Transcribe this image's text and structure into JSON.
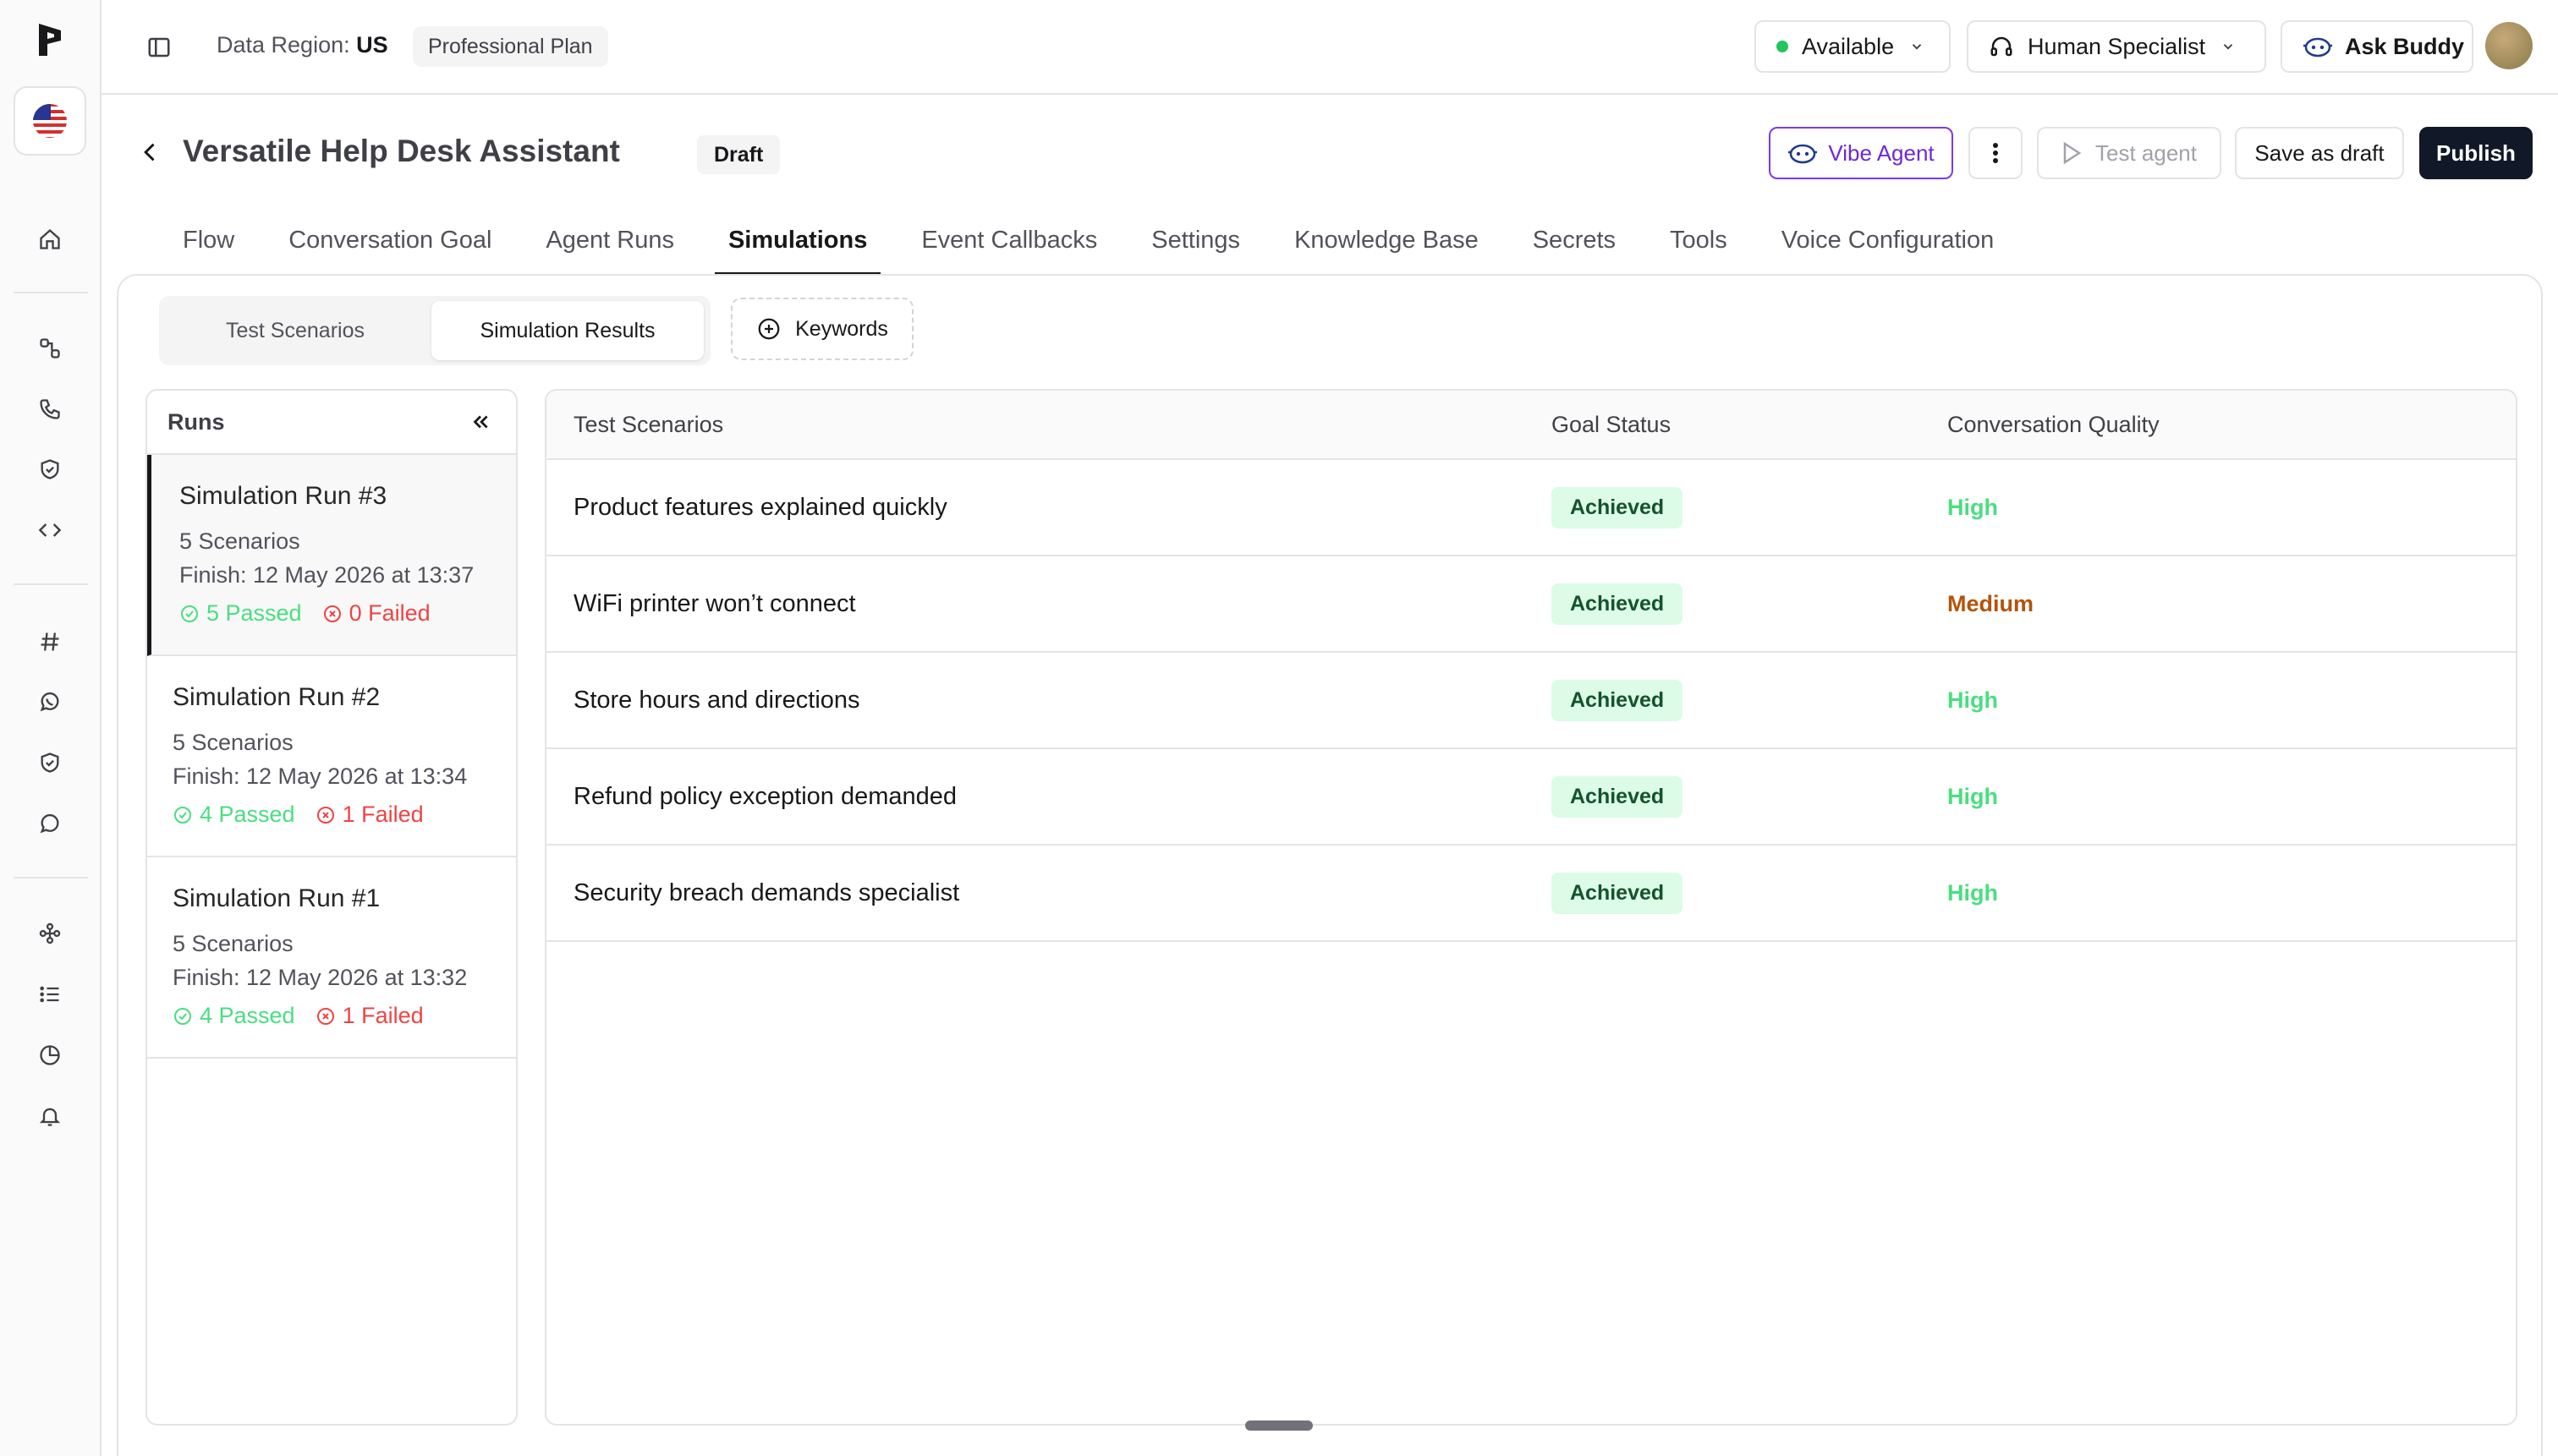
{
  "topbar": {
    "region_label": "Data Region:",
    "region_value": "US",
    "plan": "Professional Plan",
    "availability": "Available",
    "specialist": "Human Specialist",
    "ask_buddy": "Ask Buddy"
  },
  "header": {
    "title": "Versatile Help Desk Assistant",
    "status": "Draft",
    "vibe_agent": "Vibe Agent",
    "test_agent": "Test agent",
    "save_draft": "Save as draft",
    "publish": "Publish"
  },
  "tabs": [
    {
      "label": "Flow"
    },
    {
      "label": "Conversation Goal"
    },
    {
      "label": "Agent Runs"
    },
    {
      "label": "Simulations"
    },
    {
      "label": "Event Callbacks"
    },
    {
      "label": "Settings"
    },
    {
      "label": "Knowledge Base"
    },
    {
      "label": "Secrets"
    },
    {
      "label": "Tools"
    },
    {
      "label": "Voice Configuration"
    }
  ],
  "active_tab": "Simulations",
  "subtabs": {
    "test_scenarios": "Test Scenarios",
    "simulation_results": "Simulation Results",
    "keywords": "Keywords"
  },
  "runs": {
    "title": "Runs",
    "items": [
      {
        "name": "Simulation Run #3",
        "scenarios": "5 Scenarios",
        "finish": "Finish: 12 May 2026 at 13:37",
        "passed": "5 Passed",
        "failed": "0 Failed"
      },
      {
        "name": "Simulation Run #2",
        "scenarios": "5 Scenarios",
        "finish": "Finish: 12 May 2026 at 13:34",
        "passed": "4 Passed",
        "failed": "1 Failed"
      },
      {
        "name": "Simulation Run #1",
        "scenarios": "5 Scenarios",
        "finish": "Finish: 12 May 2026 at 13:32",
        "passed": "4 Passed",
        "failed": "1 Failed"
      }
    ]
  },
  "results": {
    "columns": [
      "Test Scenarios",
      "Goal Status",
      "Conversation Quality"
    ],
    "rows": [
      {
        "scenario": "Product features explained quickly",
        "goal": "Achieved",
        "quality": "High"
      },
      {
        "scenario": "WiFi printer won’t connect",
        "goal": "Achieved",
        "quality": "Medium"
      },
      {
        "scenario": "Store hours and directions",
        "goal": "Achieved",
        "quality": "High"
      },
      {
        "scenario": "Refund policy exception demanded",
        "goal": "Achieved",
        "quality": "High"
      },
      {
        "scenario": "Security breach demands specialist",
        "goal": "Achieved",
        "quality": "High"
      }
    ]
  },
  "colors": {
    "accent_purple": "#6d28d9",
    "publish_bg": "#111827",
    "achieved_bg": "#dcfce7",
    "quality_high": "#4ade80",
    "quality_medium": "#b45309",
    "passed": "#4ade80",
    "failed": "#ef4444"
  }
}
